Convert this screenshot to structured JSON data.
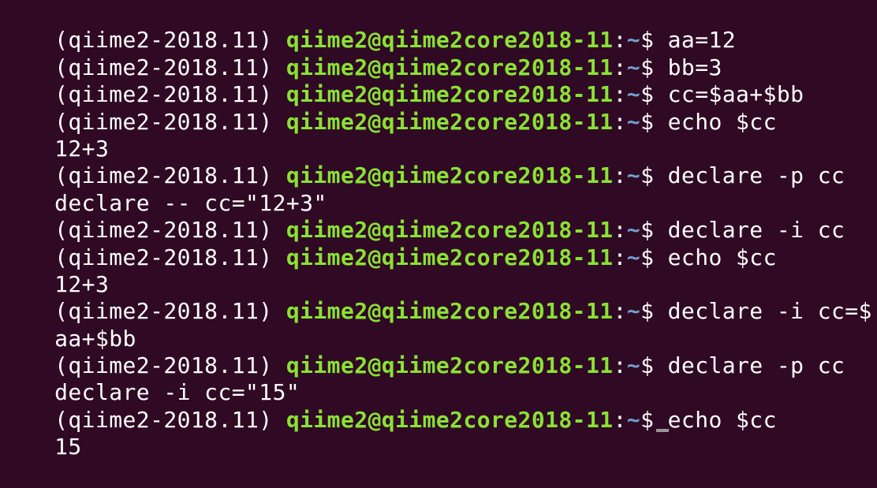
{
  "theme": {
    "background": "#300a24",
    "text": "#ffffff",
    "user_host_color": "#8ae234",
    "path_color": "#729fcf"
  },
  "prompt": {
    "env": "(qiime2-2018.11) ",
    "user_host": "qiime2@qiime2core2018-11",
    "colon": ":",
    "path": "~",
    "symbol": "$ "
  },
  "lines": [
    {
      "type": "prompt",
      "command": "aa=12"
    },
    {
      "type": "prompt",
      "command": "bb=3"
    },
    {
      "type": "prompt",
      "command": "cc=$aa+$bb"
    },
    {
      "type": "prompt",
      "command": "echo $cc"
    },
    {
      "type": "output",
      "text": "12+3"
    },
    {
      "type": "prompt",
      "command": "declare -p cc"
    },
    {
      "type": "output",
      "text": "declare -- cc=\"12+3\""
    },
    {
      "type": "prompt",
      "command": "declare -i cc"
    },
    {
      "type": "prompt",
      "command": "echo $cc"
    },
    {
      "type": "output",
      "text": "12+3"
    },
    {
      "type": "prompt",
      "command": "declare -i cc=$"
    },
    {
      "type": "output",
      "text": "aa+$bb"
    },
    {
      "type": "prompt",
      "command": "declare -p cc"
    },
    {
      "type": "output",
      "text": "declare -i cc=\"15\""
    },
    {
      "type": "prompt",
      "command": "echo $cc"
    },
    {
      "type": "output",
      "text": "15"
    }
  ]
}
